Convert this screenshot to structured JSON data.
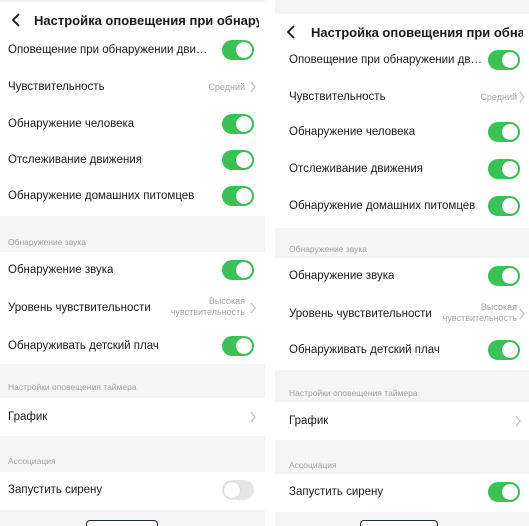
{
  "colors": {
    "toggle_on": "#3cc156",
    "toggle_off": "#e6e6e6",
    "section_bg": "#f5f5f5",
    "muted_text": "#a8a8a8"
  },
  "left": {
    "title": "Настройка оповещения при обнаруж...",
    "motion_alert": {
      "label": "Оповещение при обнаружении движ...",
      "on": true
    },
    "sensitivity": {
      "label": "Чувствительность",
      "value": "Средний"
    },
    "human_detection": {
      "label": "Обнаружение человека",
      "on": true
    },
    "motion_tracking": {
      "label": "Отслеживание движения",
      "on": true
    },
    "pet_detection": {
      "label": "Обнаружение домашних питомцев",
      "on": true
    },
    "sound_section": "Обнаружение звука",
    "sound_detection": {
      "label": "Обнаружение звука",
      "on": true
    },
    "sound_sensitivity": {
      "label": "Уровень чувствительности",
      "value_line1": "Высокая",
      "value_line2": "чувствительность"
    },
    "baby_cry": {
      "label": "Обнаруживать детский плач",
      "on": true
    },
    "timer_section": "Настройки оповещения таймера",
    "schedule": {
      "label": "График"
    },
    "association_section": "Ассоциация",
    "siren": {
      "label": "Запустить сирену",
      "on": false
    }
  },
  "right": {
    "title": "Настройка оповещения при обнаруж...",
    "motion_alert": {
      "label": "Оповещение при обнаружении движ...",
      "on": true
    },
    "sensitivity": {
      "label": "Чувствительность",
      "value": "Средний"
    },
    "human_detection": {
      "label": "Обнаружение человека",
      "on": true
    },
    "motion_tracking": {
      "label": "Отслеживание движения",
      "on": true
    },
    "pet_detection": {
      "label": "Обнаружение домашних питомцев",
      "on": true
    },
    "sound_section": "Обнаружение звука",
    "sound_detection": {
      "label": "Обнаружение звука",
      "on": true
    },
    "sound_sensitivity": {
      "label": "Уровень чувствительности",
      "value_line1": "Высокая",
      "value_line2": "чувствительность"
    },
    "baby_cry": {
      "label": "Обнаруживать детский плач",
      "on": true
    },
    "timer_section": "Настройки оповещения таймера",
    "schedule": {
      "label": "График"
    },
    "association_section": "Ассоциация",
    "siren": {
      "label": "Запустить сирену",
      "on": true
    }
  }
}
